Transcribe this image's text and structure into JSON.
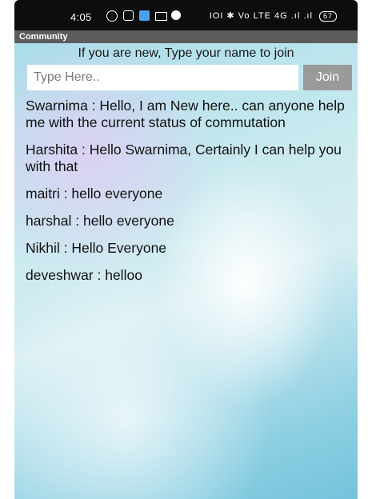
{
  "status_bar": {
    "time": "4:05",
    "right_icons_text": "IOI ✱ Vo LTE 4G .ıl .ıl",
    "battery": "67"
  },
  "app": {
    "title": "Community"
  },
  "join": {
    "prompt": "If you are new, Type your name to join",
    "placeholder": "Type Here..",
    "value": "",
    "button_label": "Join"
  },
  "messages": [
    {
      "text": "Swarnima : Hello, I am New here.. can anyone help me with the current status of commutation"
    },
    {
      "text": "Harshita : Hello Swarnima, Certainly I can help you with that"
    },
    {
      "text": "maitri : hello everyone"
    },
    {
      "text": "harshal : hello everyone"
    },
    {
      "text": "Nikhil : Hello Everyone"
    },
    {
      "text": "deveshwar : helloo"
    }
  ],
  "icons": [
    "whatsapp-icon",
    "instagram-icon",
    "teams-icon",
    "mail-icon",
    "app-icon",
    "vibrate-icon",
    "bluetooth-icon",
    "volte-icon",
    "signal-icon",
    "battery-icon"
  ],
  "colors": {
    "title_bar": "#5c5c5c",
    "join_button": "#9a9a9a",
    "background_accent": "#8ccfe2"
  }
}
